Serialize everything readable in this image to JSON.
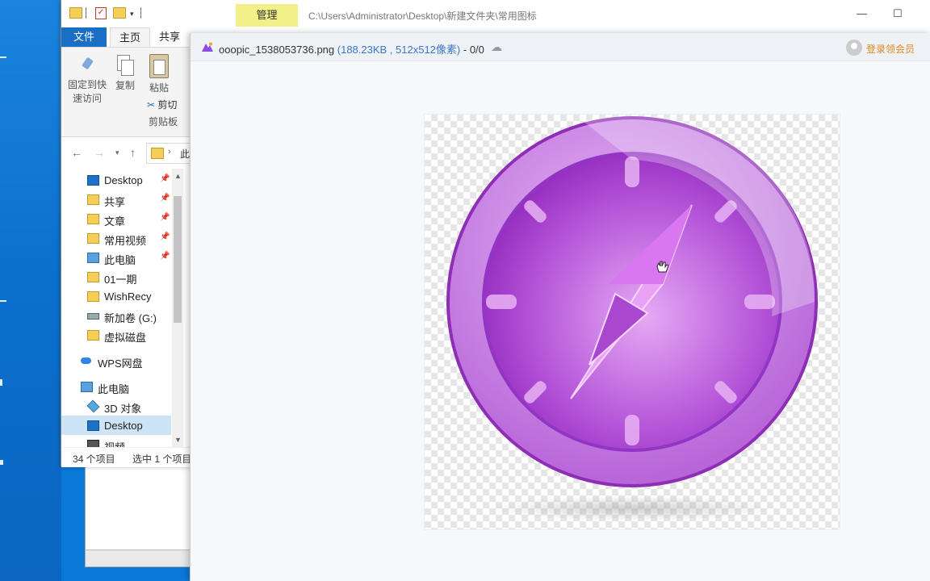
{
  "explorer": {
    "context_tab": "管理",
    "title_path": "C:\\Users\\Administrator\\Desktop\\新建文件夹\\常用图标",
    "window_buttons": {
      "minimize": "—",
      "maximize": "☐"
    },
    "ribbon_tabs": {
      "file": "文件",
      "home": "主页",
      "share": "共享"
    },
    "ribbon": {
      "pin_label": "固定到快速访问",
      "pin_label_line1": "固定到快",
      "pin_label_line2": "速访问",
      "copy_label": "复制",
      "paste_label": "粘贴",
      "cut_label": "剪切",
      "group_label": "剪贴板"
    },
    "address": {
      "segment": "此"
    },
    "nav_items": [
      {
        "label": "Desktop",
        "icon": "desktop-icon",
        "pinned": true
      },
      {
        "label": "共享",
        "icon": "folder-icon",
        "pinned": true
      },
      {
        "label": "文章",
        "icon": "folder-icon",
        "pinned": true
      },
      {
        "label": "常用视频",
        "icon": "folder-icon",
        "pinned": true
      },
      {
        "label": "此电脑",
        "icon": "computer-icon",
        "pinned": true
      },
      {
        "label": "01一期",
        "icon": "folder-icon",
        "pinned": false
      },
      {
        "label": "WishRecy",
        "icon": "folder-icon",
        "pinned": false
      },
      {
        "label": "新加卷 (G:)",
        "icon": "drive-icon",
        "pinned": false
      },
      {
        "label": "虚拟磁盘",
        "icon": "folder-icon",
        "pinned": false
      },
      {
        "label": "WPS网盘",
        "icon": "cloud-icon",
        "pinned": false
      },
      {
        "label": "此电脑",
        "icon": "computer-icon",
        "pinned": false
      },
      {
        "label": "3D 对象",
        "icon": "3d-objects-icon",
        "pinned": false
      },
      {
        "label": "Desktop",
        "icon": "desktop-icon",
        "pinned": false,
        "selected": true
      },
      {
        "label": "视频",
        "icon": "video-icon",
        "pinned": false
      }
    ],
    "status": {
      "count": "34 个项目",
      "selection": "选中 1 个项目"
    }
  },
  "viewer": {
    "filename": "ooopic_1538053736.png",
    "meta": "(188.23KB , 512x512像素)",
    "index": "- 0/0",
    "login": "登录领会员",
    "image": {
      "subject": "purple compass icon",
      "colors": {
        "rim": "#b865d8",
        "face": "#a442d0",
        "needle": "#e8a6f5",
        "accent": "#8a1fb8"
      }
    }
  }
}
